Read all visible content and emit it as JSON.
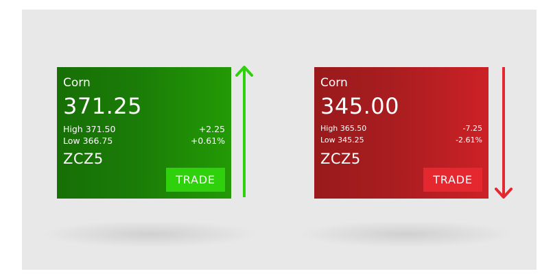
{
  "colors": {
    "up_accent": "#2ed10b",
    "down_accent": "#e52730",
    "up_card": "#1a7c07",
    "down_card": "#a91d20",
    "background": "#e8e8e8"
  },
  "tickers": [
    {
      "name": "Corn",
      "price": "371.25",
      "high": "High 371.50",
      "low": "Low 366.75",
      "change": "+2.25",
      "change_pct": "+0.61%",
      "symbol": "ZCZ5",
      "trade_label": "TRADE",
      "direction": "up",
      "arrow_icon": "arrow-up-icon"
    },
    {
      "name": "Corn",
      "price": "345.00",
      "high": "High 365.50",
      "low": "Low 345.25",
      "change": "-7.25",
      "change_pct": "-2.61%",
      "symbol": "ZCZ5",
      "trade_label": "TRADE",
      "direction": "down",
      "arrow_icon": "arrow-down-icon"
    }
  ]
}
